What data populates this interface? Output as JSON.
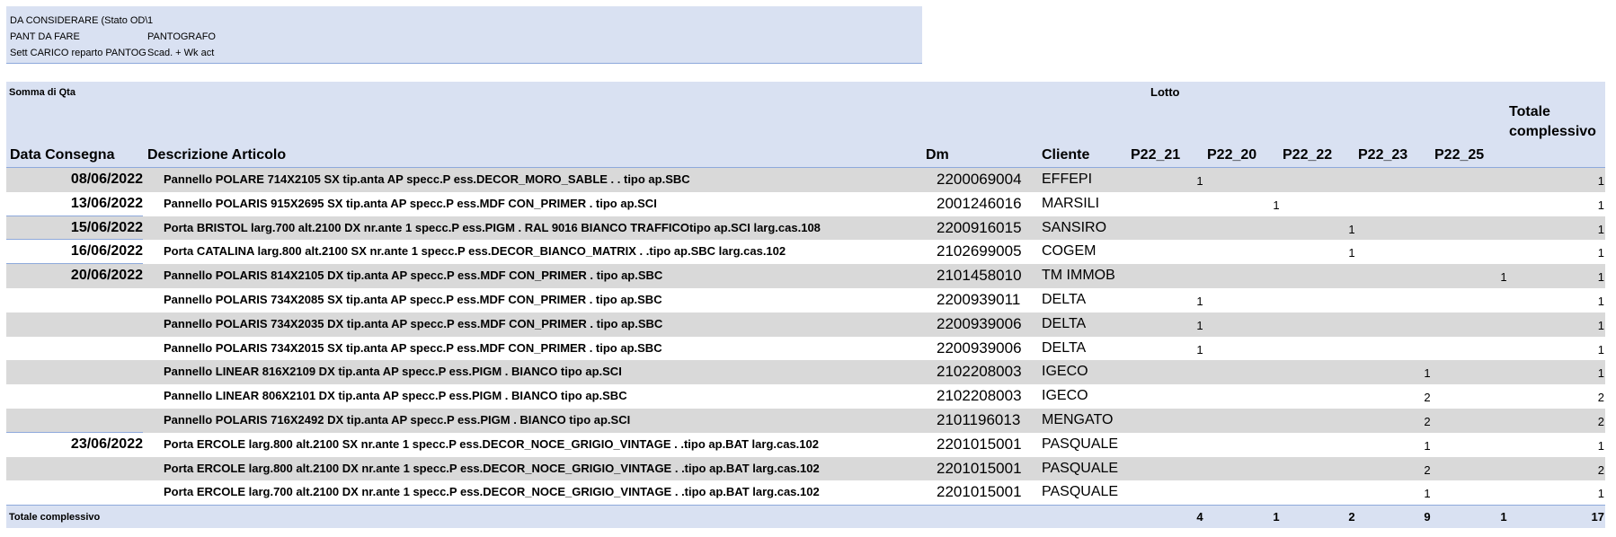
{
  "filters": [
    {
      "label": "DA CONSIDERARE (Stato OD\\",
      "value": "1"
    },
    {
      "label": "PANT DA FARE",
      "value": "PANTOGRAFO"
    },
    {
      "label": "Sett CARICO reparto PANTOG",
      "value": "Scad. + Wk act"
    }
  ],
  "pivot": {
    "value_field": "Somma di Qta",
    "column_field": "Lotto",
    "grand_total_header": "Totale complessivo",
    "headers": {
      "date": "Data Consegna",
      "desc": "Descrizione Articolo",
      "dm": "Dm",
      "client": "Cliente"
    },
    "lots": [
      "P22_21",
      "P22_20",
      "P22_22",
      "P22_23",
      "P22_25"
    ],
    "rows": [
      {
        "date": "08/06/2022",
        "desc": "Pannello POLARE 714X2105 SX  tip.anta AP specc.P ess.DECOR_MORO_SABLE . . tipo ap.SBC",
        "dm": "2200069004",
        "client": "EFFEPI",
        "vals": [
          "1",
          "",
          "",
          "",
          ""
        ],
        "total": "1"
      },
      {
        "date": "13/06/2022",
        "desc": "Pannello POLARIS 915X2695 SX  tip.anta AP specc.P ess.MDF CON_PRIMER . tipo ap.SCI",
        "dm": "2001246016",
        "client": "MARSILI",
        "vals": [
          "",
          "1",
          "",
          "",
          ""
        ],
        "total": "1"
      },
      {
        "date": "15/06/2022",
        "desc": "Porta BRISTOL larg.700 alt.2100 DX nr.ante 1 specc.P   ess.PIGM . RAL 9016 BIANCO TRAFFICOtipo ap.SCI larg.cas.108",
        "dm": "2200916015",
        "client": "SANSIRO",
        "vals": [
          "",
          "",
          "1",
          "",
          ""
        ],
        "total": "1"
      },
      {
        "date": "16/06/2022",
        "desc": "Porta CATALINA larg.800 alt.2100 SX nr.ante 1 specc.P   ess.DECOR_BIANCO_MATRIX . .tipo ap.SBC larg.cas.102",
        "dm": "2102699005",
        "client": "COGEM",
        "vals": [
          "",
          "",
          "1",
          "",
          ""
        ],
        "total": "1"
      },
      {
        "date": "20/06/2022",
        "desc": "Pannello POLARIS 814X2105 DX  tip.anta AP specc.P ess.MDF CON_PRIMER . tipo ap.SBC",
        "dm": "2101458010",
        "client": "TM IMMOB",
        "vals": [
          "",
          "",
          "",
          "",
          "1"
        ],
        "total": "1"
      },
      {
        "date": "",
        "desc": "Pannello POLARIS 734X2085 SX  tip.anta AP specc.P ess.MDF CON_PRIMER . tipo ap.SBC",
        "dm": "2200939011",
        "client": "DELTA",
        "vals": [
          "1",
          "",
          "",
          "",
          ""
        ],
        "total": "1"
      },
      {
        "date": "",
        "desc": "Pannello POLARIS 734X2035 DX  tip.anta AP specc.P ess.MDF CON_PRIMER . tipo ap.SBC",
        "dm": "2200939006",
        "client": "DELTA",
        "vals": [
          "1",
          "",
          "",
          "",
          ""
        ],
        "total": "1"
      },
      {
        "date": "",
        "desc": "Pannello POLARIS 734X2015 SX  tip.anta AP specc.P ess.MDF CON_PRIMER . tipo ap.SBC",
        "dm": "2200939006",
        "client": "DELTA",
        "vals": [
          "1",
          "",
          "",
          "",
          ""
        ],
        "total": "1"
      },
      {
        "date": "",
        "desc": "Pannello LINEAR 816X2109 DX  tip.anta AP specc.P ess.PIGM . BIANCO tipo ap.SCI",
        "dm": "2102208003",
        "client": "IGECO",
        "vals": [
          "",
          "",
          "",
          "1",
          ""
        ],
        "total": "1"
      },
      {
        "date": "",
        "desc": "Pannello LINEAR 806X2101 DX  tip.anta AP specc.P ess.PIGM . BIANCO tipo ap.SBC",
        "dm": "2102208003",
        "client": "IGECO",
        "vals": [
          "",
          "",
          "",
          "2",
          ""
        ],
        "total": "2"
      },
      {
        "date": "",
        "desc": "Pannello POLARIS 716X2492 DX  tip.anta AP specc.P ess.PIGM . BIANCO tipo ap.SCI",
        "dm": "2101196013",
        "client": "MENGATO",
        "vals": [
          "",
          "",
          "",
          "2",
          ""
        ],
        "total": "2"
      },
      {
        "date": "23/06/2022",
        "desc": "Porta ERCOLE larg.800 alt.2100 SX nr.ante 1 specc.P   ess.DECOR_NOCE_GRIGIO_VINTAGE . .tipo ap.BAT larg.cas.102",
        "dm": "2201015001",
        "client": "PASQUALE",
        "vals": [
          "",
          "",
          "",
          "1",
          ""
        ],
        "total": "1"
      },
      {
        "date": "",
        "desc": "Porta ERCOLE larg.800 alt.2100 DX nr.ante 1 specc.P   ess.DECOR_NOCE_GRIGIO_VINTAGE . .tipo ap.BAT larg.cas.102",
        "dm": "2201015001",
        "client": "PASQUALE",
        "vals": [
          "",
          "",
          "",
          "2",
          ""
        ],
        "total": "2"
      },
      {
        "date": "",
        "desc": "Porta ERCOLE larg.700 alt.2100 DX nr.ante 1 specc.P   ess.DECOR_NOCE_GRIGIO_VINTAGE . .tipo ap.BAT larg.cas.102",
        "dm": "2201015001",
        "client": "PASQUALE",
        "vals": [
          "",
          "",
          "",
          "1",
          ""
        ],
        "total": "1"
      }
    ],
    "footer": {
      "label": "Totale complessivo",
      "vals": [
        "4",
        "1",
        "2",
        "9",
        "1"
      ],
      "total": "17"
    }
  },
  "colors": {
    "header_bg": "#d9e1f2",
    "band_bg": "#d9d9d9",
    "border": "#8ea9db"
  }
}
